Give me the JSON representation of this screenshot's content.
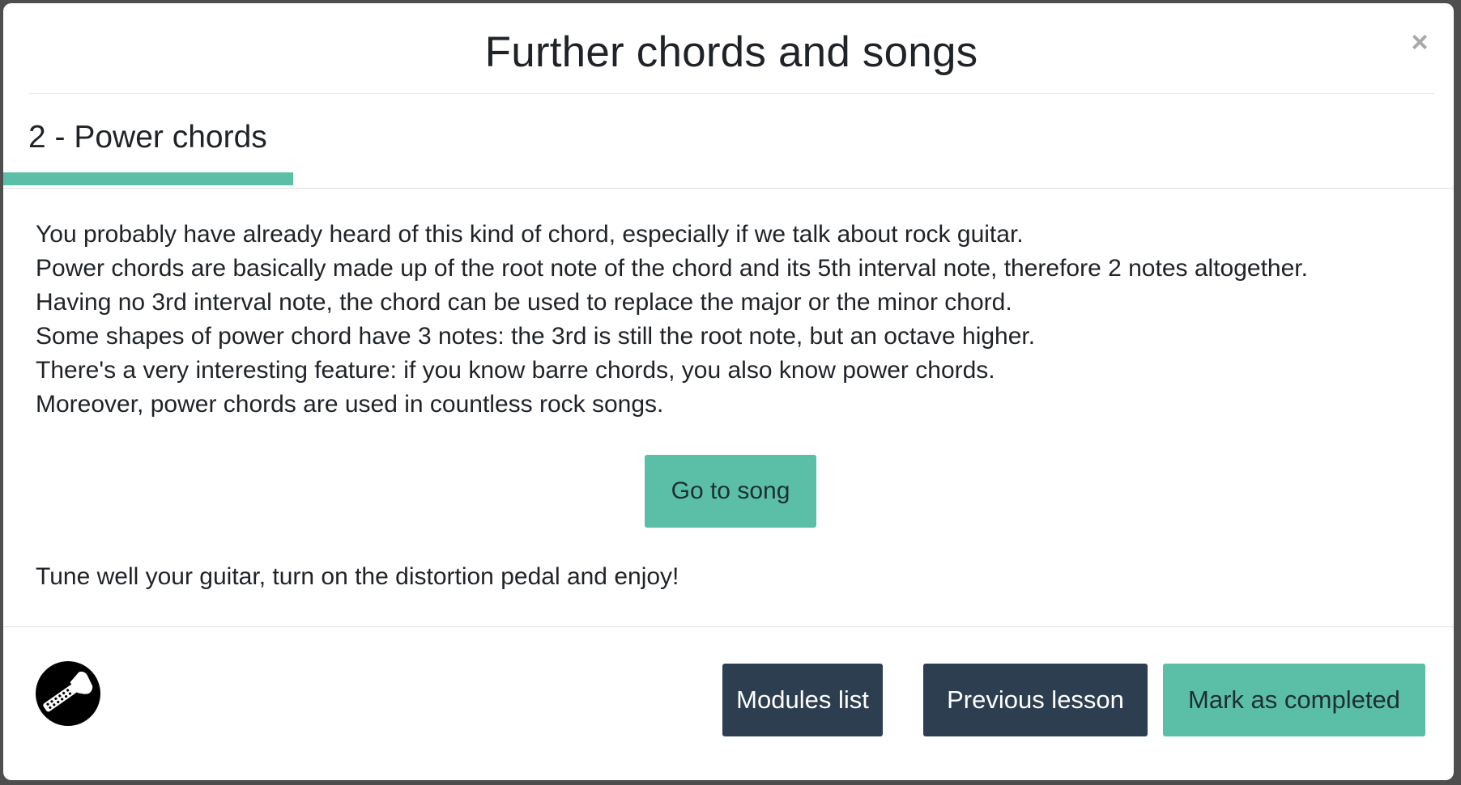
{
  "modal": {
    "title": "Further chords and songs",
    "close_symbol": "×",
    "close_icon": "close-icon"
  },
  "lesson": {
    "title": "2 - Power chords",
    "progress_fraction": 0.2,
    "accent_color": "#5bbfa8"
  },
  "content": {
    "paragraphs": [
      "You probably have already heard of this kind of chord, especially if we talk about rock guitar.",
      "Power chords are basically made up of the root note of the chord and its 5th interval note, therefore 2 notes altogether.",
      "Having no 3rd interval note, the chord can be used to replace the major or the minor chord.",
      "Some shapes of power chord have 3 notes: the 3rd is still the root note, but an octave higher.",
      "There's a very interesting feature: if you know barre chords, you also know power chords.",
      "Moreover, power chords are used in countless rock songs."
    ],
    "song_button_label": "Go to song",
    "closing_text": "Tune well your guitar, turn on the distortion pedal and enjoy!"
  },
  "footer": {
    "logo_icon": "guitar-logo-icon",
    "modules_label": "Modules list",
    "previous_label": "Previous lesson",
    "complete_label": "Mark as completed",
    "dark_color": "#2c3e50"
  }
}
